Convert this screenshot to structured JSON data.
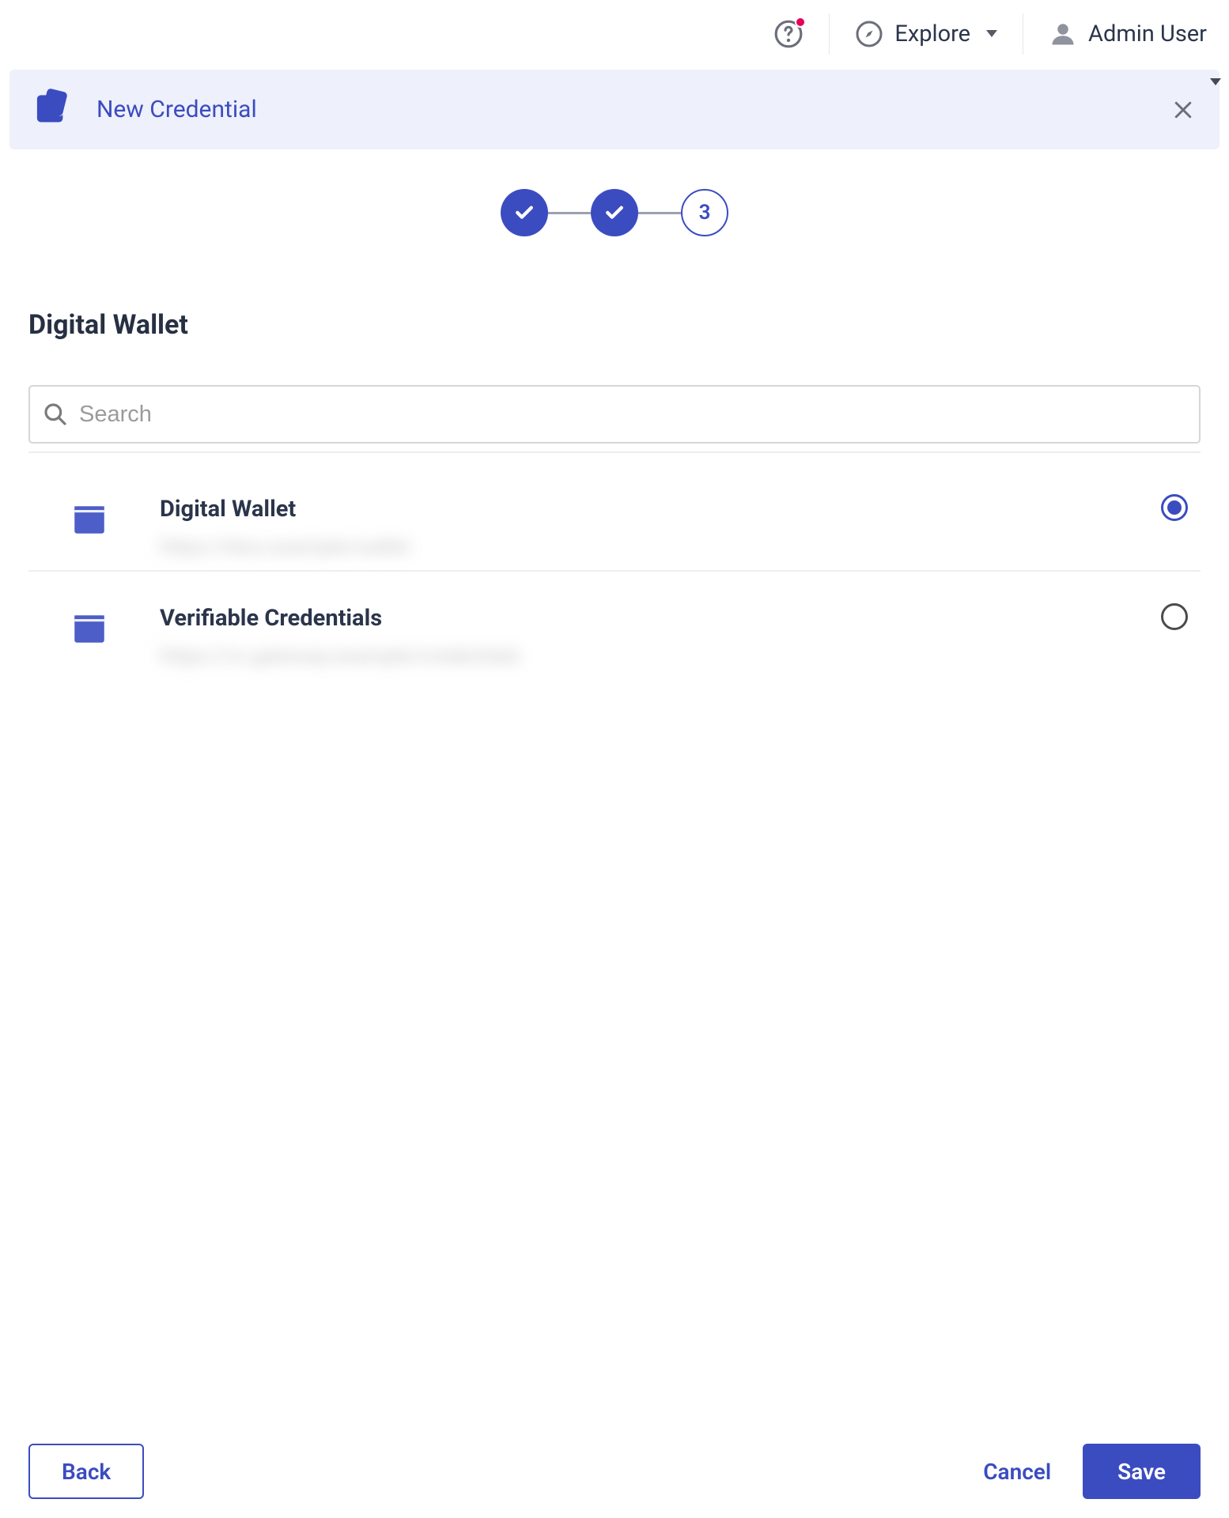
{
  "topbar": {
    "explore_label": "Explore",
    "user_label": "Admin User"
  },
  "sheet": {
    "title": "New Credential"
  },
  "stepper": {
    "current_number": "3"
  },
  "section": {
    "title": "Digital Wallet",
    "search_placeholder": "Search"
  },
  "options": [
    {
      "title": "Digital Wallet",
      "subtitle": "https://dws.example/wallet",
      "selected": true
    },
    {
      "title": "Verifiable Credentials",
      "subtitle": "https://vc.gateway.example/credentials",
      "selected": false
    }
  ],
  "footer": {
    "back": "Back",
    "cancel": "Cancel",
    "save": "Save"
  }
}
